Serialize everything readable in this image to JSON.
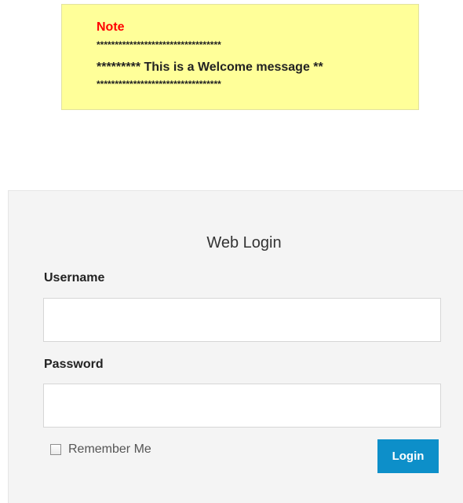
{
  "note": {
    "title": "Note",
    "stars_top": "**********************************",
    "message": "********* This is a Welcome message **",
    "stars_bottom": "**********************************"
  },
  "login": {
    "title": "Web Login",
    "username_label": "Username",
    "username_value": "",
    "password_label": "Password",
    "password_value": "",
    "remember_label": "Remember Me",
    "remember_checked": false,
    "button_label": "Login"
  },
  "colors": {
    "note_background": "#ffff99",
    "note_title": "#ff0000",
    "panel_background": "#f4f4f4",
    "button_background": "#0d8fc9",
    "button_text": "#ffffff"
  }
}
